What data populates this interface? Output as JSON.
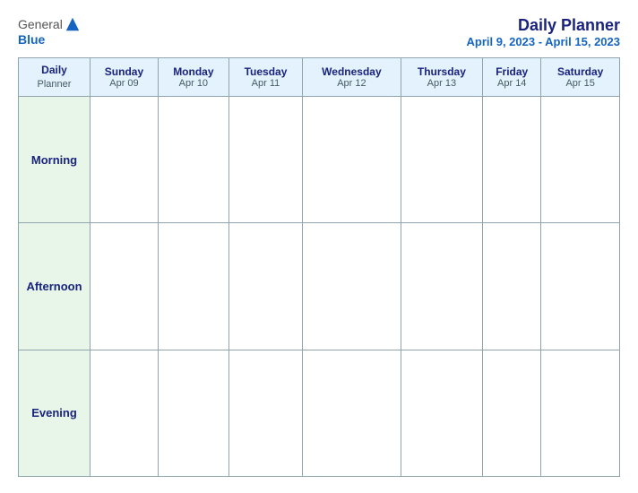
{
  "header": {
    "logo": {
      "general": "General",
      "blue": "Blue",
      "icon_alt": "GeneralBlue logo"
    },
    "title": "Daily Planner",
    "date_range": "April 9, 2023 - April 15, 2023"
  },
  "table": {
    "label_header_line1": "Daily",
    "label_header_line2": "Planner",
    "days": [
      {
        "name": "Sunday",
        "date": "Apr 09"
      },
      {
        "name": "Monday",
        "date": "Apr 10"
      },
      {
        "name": "Tuesday",
        "date": "Apr 11"
      },
      {
        "name": "Wednesday",
        "date": "Apr 12"
      },
      {
        "name": "Thursday",
        "date": "Apr 13"
      },
      {
        "name": "Friday",
        "date": "Apr 14"
      },
      {
        "name": "Saturday",
        "date": "Apr 15"
      }
    ],
    "rows": [
      {
        "label": "Morning"
      },
      {
        "label": "Afternoon"
      },
      {
        "label": "Evening"
      }
    ]
  }
}
